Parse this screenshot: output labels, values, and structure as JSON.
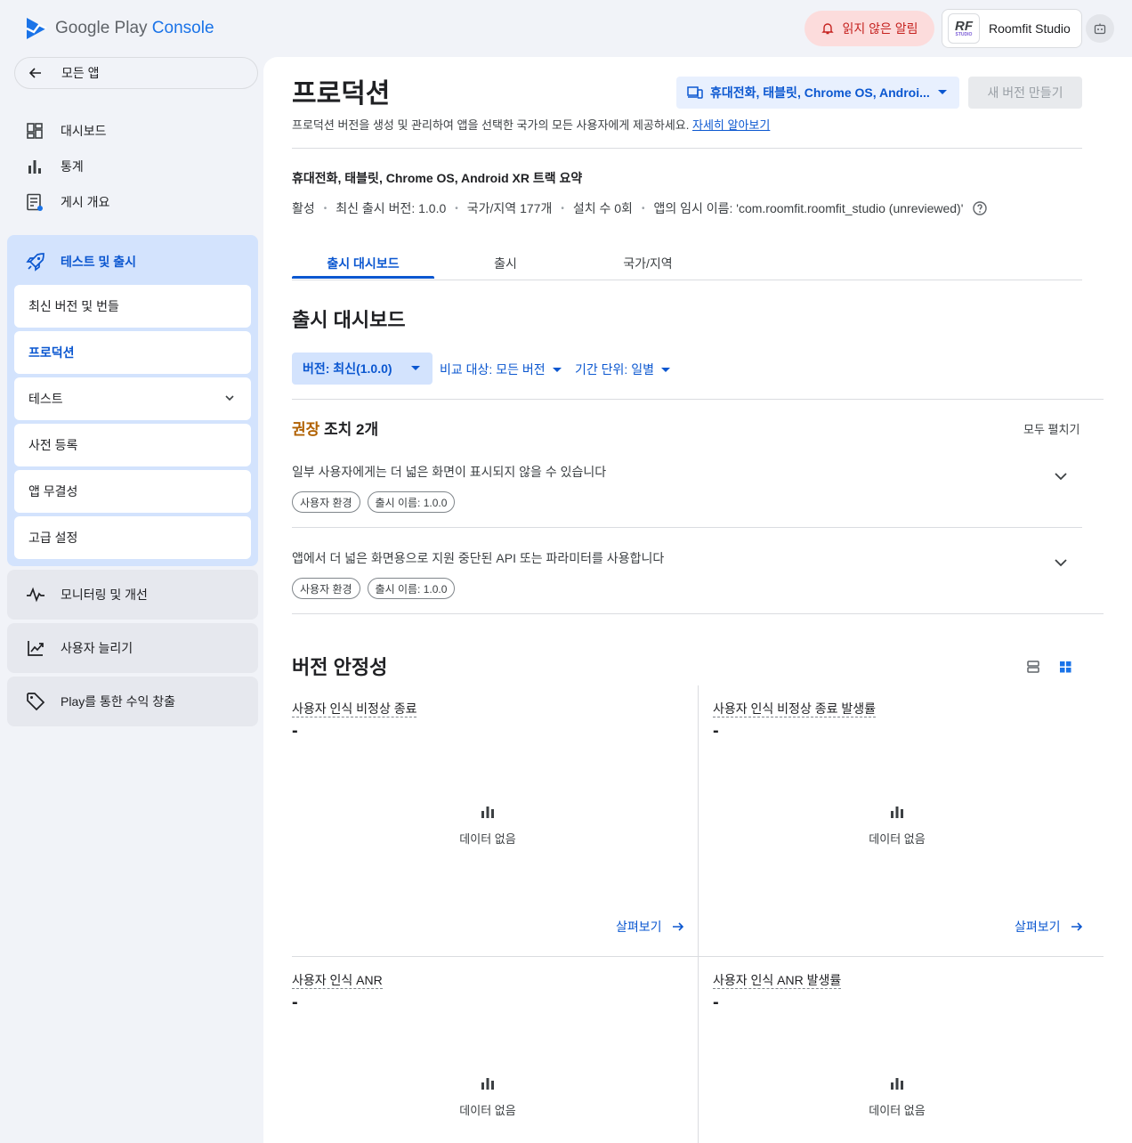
{
  "app": {
    "logo_text_a": "Google Play",
    "logo_text_b": "Console"
  },
  "topbar": {
    "notifications": "읽지 않은 알림",
    "account_name": "Roomfit Studio",
    "account_badge": "RF",
    "account_badge_sub": "STUDIO"
  },
  "sidebar": {
    "all_apps": "모든 앱",
    "items": [
      {
        "label": "대시보드",
        "icon": "dashboard-icon"
      },
      {
        "label": "통계",
        "icon": "bar-chart-icon"
      },
      {
        "label": "게시 개요",
        "icon": "publish-overview-icon"
      }
    ],
    "group": {
      "label": "테스트 및 출시",
      "icon": "rocket-icon",
      "children": [
        "최신 버전 및 번들",
        "프로덕션",
        "테스트",
        "사전 등록",
        "앱 무결성",
        "고급 설정"
      ]
    },
    "blocks": [
      {
        "label": "모니터링 및 개선",
        "icon": "pulse-icon"
      },
      {
        "label": "사용자 늘리기",
        "icon": "growth-icon"
      },
      {
        "label": "Play를 통한 수익 창출",
        "icon": "tag-icon"
      }
    ]
  },
  "page": {
    "title": "프로덕션",
    "device_selector": "휴대전화, 태블릿, Chrome OS, Androi...",
    "new_version_button": "새 버전 만들기",
    "description": "프로덕션 버전을 생성 및 관리하여 앱을 선택한 국가의 모든 사용자에게 제공하세요.",
    "learn_more": "자세히 알아보기",
    "summary_title": "휴대전화, 태블릿, Chrome OS, Android XR 트랙 요약",
    "summary_meta": [
      "활성",
      "최신 출시 버전: 1.0.0",
      "국가/지역 177개",
      "설치 수 0회",
      "앱의 임시 이름: 'com.roomfit.roomfit_studio (unreviewed)'"
    ],
    "tabs": [
      "출시 대시보드",
      "출시",
      "국가/지역"
    ]
  },
  "dashboard": {
    "title": "출시 대시보드",
    "filters": {
      "version": "버전: 최신(1.0.0)",
      "compare": "비교 대상: 모든 버전",
      "period": "기간 단위: 일별"
    },
    "recommendations": {
      "title_prefix": "권장",
      "title_suffix": "조치 2개",
      "expand_all": "모두 펼치기",
      "items": [
        {
          "text": "일부 사용자에게는 더 넓은 화면이 표시되지 않을 수 있습니다",
          "chips": [
            "사용자 환경",
            "출시 이름: 1.0.0"
          ]
        },
        {
          "text": "앱에서 더 넓은 화면용으로 지원 중단된 API 또는 파라미터를 사용합니다",
          "chips": [
            "사용자 환경",
            "출시 이름: 1.0.0"
          ]
        }
      ]
    },
    "stability": {
      "title": "버전 안정성",
      "metrics": [
        {
          "label": "사용자 인식 비정상 종료",
          "value": "-",
          "no_data": "데이터 없음",
          "explore": "살펴보기"
        },
        {
          "label": "사용자 인식 비정상 종료 발생률",
          "value": "-",
          "no_data": "데이터 없음",
          "explore": "살펴보기"
        },
        {
          "label": "사용자 인식 ANR",
          "value": "-",
          "no_data": "데이터 없음"
        },
        {
          "label": "사용자 인식 ANR 발생률",
          "value": "-",
          "no_data": "데이터 없음"
        }
      ]
    }
  }
}
